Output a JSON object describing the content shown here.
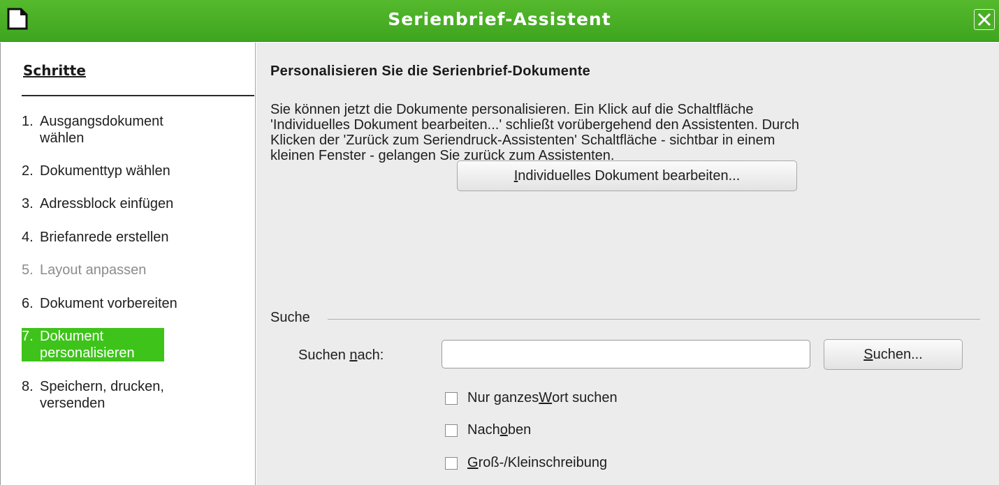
{
  "window": {
    "title": "Serienbrief-Assistent",
    "accent_color": "#3ec31a",
    "close_icon": "close-icon",
    "app_icon": "document-icon"
  },
  "sidebar": {
    "title": "Schritte",
    "steps": [
      {
        "num": "1.",
        "label": "Ausgangsdokument wählen",
        "state": "normal"
      },
      {
        "num": "2.",
        "label": "Dokumenttyp wählen",
        "state": "normal"
      },
      {
        "num": "3.",
        "label": "Adressblock einfügen",
        "state": "normal"
      },
      {
        "num": "4.",
        "label": "Briefanrede erstellen",
        "state": "normal"
      },
      {
        "num": "5.",
        "label": "Layout anpassen",
        "state": "disabled"
      },
      {
        "num": "6.",
        "label": "Dokument vorbereiten",
        "state": "normal"
      },
      {
        "num": "7.",
        "label": "Dokument personalisieren",
        "state": "active"
      },
      {
        "num": "8.",
        "label": "Speichern, drucken, versenden",
        "state": "normal"
      }
    ]
  },
  "main": {
    "heading": "Personalisieren Sie die Serienbrief-Dokumente",
    "description_lines": [
      "Sie können jetzt die Dokumente personalisieren. Ein Klick auf die Schaltfläche",
      "'Individuelles Dokument bearbeiten...' schließt vorübergehend den Assistenten. Durch",
      "Klicken der 'Zurück zum Seriendruck-Assistenten' Schaltfläche - sichtbar in einem",
      "kleinen Fenster - gelangen Sie zurück zum Assistenten."
    ],
    "edit_button": {
      "mnemonic": "I",
      "rest": "ndividuelles Dokument bearbeiten..."
    },
    "search_group": {
      "label": "Suche",
      "search_label_pre": "Suchen ",
      "search_label_mnemonic": "n",
      "search_label_post": "ach:",
      "search_value": "",
      "search_button": {
        "mnemonic": "S",
        "rest": "uchen..."
      },
      "options": [
        {
          "pre": "Nur ganzes ",
          "mnemonic": "W",
          "post": "ort suchen",
          "checked": false
        },
        {
          "pre": "Nach ",
          "mnemonic": "o",
          "post": "ben",
          "checked": false
        },
        {
          "pre": "",
          "mnemonic": "G",
          "post": "roß-/Kleinschreibung",
          "checked": false
        }
      ]
    }
  }
}
